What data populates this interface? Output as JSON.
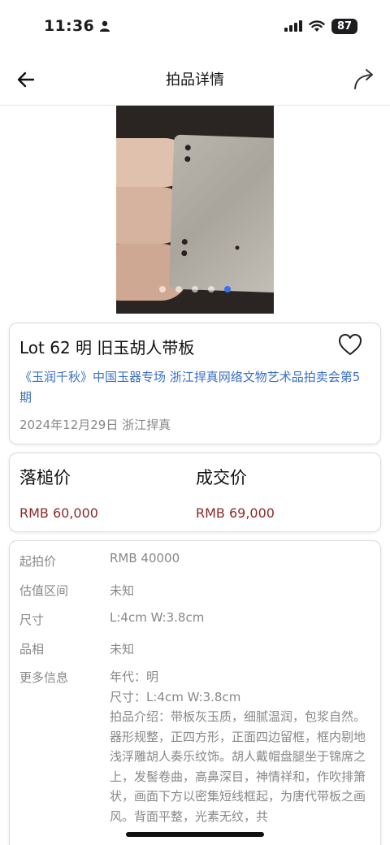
{
  "status": {
    "time": "11:36",
    "battery": "87"
  },
  "nav": {
    "title": "拍品详情"
  },
  "gallery": {
    "total": 5,
    "active_index": 4
  },
  "lot": {
    "title": "Lot 62 明 旧玉胡人带板",
    "auction": "《玉润千秋》中国玉器专场 浙江捍真网络文物艺术品拍卖会第5期",
    "date_house": "2024年12月29日  浙江捍真"
  },
  "prices": {
    "hammer_label": "落槌价",
    "hammer_value": "RMB 60,000",
    "deal_label": "成交价",
    "deal_value": "RMB 69,000"
  },
  "details": {
    "start_label": "起拍价",
    "start_value": "RMB 40000",
    "estimate_label": "估值区间",
    "estimate_value": "未知",
    "size_label": "尺寸",
    "size_value": "L:4cm  W:3.8cm",
    "condition_label": "品相",
    "condition_value": "未知",
    "more_label": "更多信息",
    "more_era": "年代：明",
    "more_size": "尺寸：L:4cm  W:3.8cm",
    "more_desc": "拍品介绍：带板灰玉质，细腻温润，包浆自然。器形规整，正四方形，正面四边留框，框内剔地浅浮雕胡人奏乐纹饰。胡人戴帽盘腿坐于锦席之上，发髻卷曲，高鼻深目，神情祥和，作吹排箫状，画面下方以密集短线框起，为唐代带板之画风。背面平整，光素无纹，共"
  },
  "icons": {
    "back": "arrow-left-icon",
    "share": "share-arrow-icon",
    "favorite": "heart-outline-icon",
    "person": "person-icon",
    "signal": "signal-icon",
    "wifi": "wifi-icon"
  }
}
